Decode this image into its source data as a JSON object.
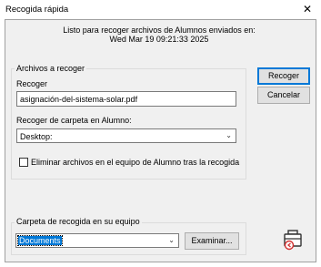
{
  "window": {
    "title": "Recogida rápida",
    "close_label": "✕"
  },
  "message": {
    "line1": "Listo para recoger archivos de Alumnos enviados en:",
    "line2": "Wed Mar 19 09:21:33 2025"
  },
  "files_group": {
    "legend": "Archivos a recoger",
    "collect_label": "Recoger",
    "collect_value": "asignación-del-sistema-solar.pdf",
    "folder_label": "Recoger de carpeta en Alumno:",
    "folder_value": "Desktop:",
    "delete_checkbox_label": "Eliminar archivos en el equipo de Alumno tras la recogida",
    "delete_checked": false
  },
  "buttons": {
    "collect": "Recoger",
    "cancel": "Cancelar"
  },
  "dest_group": {
    "legend": "Carpeta de recogida en su equipo",
    "folder_value": "Documents",
    "browse": "Examinar..."
  },
  "icons": {
    "arrow": "chevron-down-icon",
    "tool": "briefcase-collect-icon"
  }
}
